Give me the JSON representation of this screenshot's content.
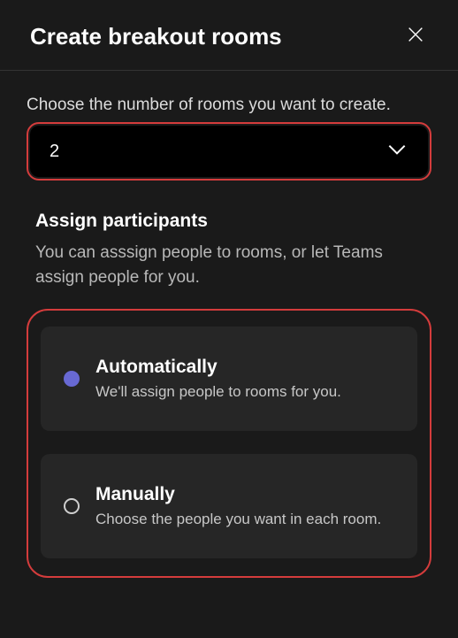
{
  "header": {
    "title": "Create breakout rooms"
  },
  "roomCount": {
    "prompt": "Choose the number of rooms you want to create.",
    "value": "2"
  },
  "assign": {
    "title": "Assign participants",
    "description": "You can asssign people to rooms, or let Teams assign people for you.",
    "options": [
      {
        "title": "Automatically",
        "description": "We'll assign people to rooms for you.",
        "selected": true
      },
      {
        "title": "Manually",
        "description": "Choose the people you want in each room.",
        "selected": false
      }
    ]
  },
  "colors": {
    "highlight_border": "#d43c3c",
    "accent_radio": "#6869d3"
  }
}
